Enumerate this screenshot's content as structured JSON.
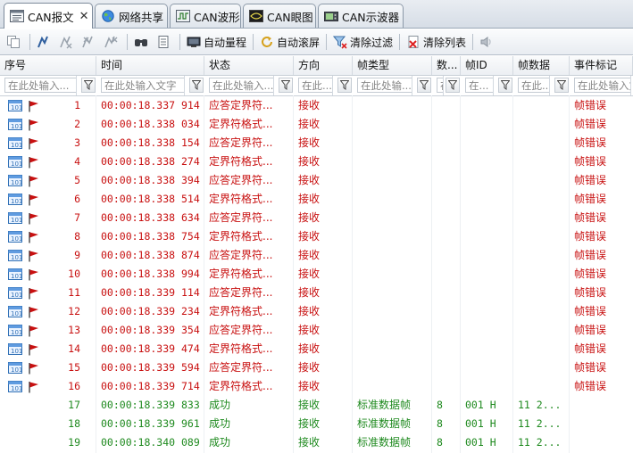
{
  "colors": {
    "error_text": "#c81010",
    "success_text": "#1f8a1f"
  },
  "tabs": [
    {
      "label": "CAN报文",
      "icon": "message-list-icon",
      "active": true,
      "close": "✕"
    },
    {
      "label": "网络共享",
      "icon": "globe-icon",
      "active": false
    },
    {
      "label": "CAN波形",
      "icon": "waveform-icon",
      "active": false
    },
    {
      "label": "CAN眼图",
      "icon": "eye-diagram-icon",
      "active": false
    },
    {
      "label": "CAN示波器",
      "icon": "oscilloscope-icon",
      "active": false
    }
  ],
  "toolbar": {
    "auto_scale_label": "自动量程",
    "auto_scroll_label": "自动滚屏",
    "clear_filter_label": "清除过滤",
    "clear_list_label": "清除列表"
  },
  "columns": [
    {
      "label": "序号",
      "filter": "在此处输入..."
    },
    {
      "label": "时间",
      "filter": "在此处输入文字"
    },
    {
      "label": "状态",
      "filter": "在此处输入..."
    },
    {
      "label": "方向",
      "filter": "在此..."
    },
    {
      "label": "帧类型",
      "filter": "在此处输..."
    },
    {
      "label": "数...",
      "filter": "在"
    },
    {
      "label": "帧ID",
      "filter": "在..."
    },
    {
      "label": "帧数据",
      "filter": "在此..."
    },
    {
      "label": "事件标记",
      "filter": "在此处输入文"
    }
  ],
  "rows": [
    {
      "no": "1",
      "time": "00:00:18.337 914",
      "status": "应答定界符...",
      "dir": "接收",
      "frame_type": "",
      "len": "",
      "id": "",
      "data": "",
      "event": "帧错误",
      "kind": "error"
    },
    {
      "no": "2",
      "time": "00:00:18.338 034",
      "status": "定界符格式...",
      "dir": "接收",
      "frame_type": "",
      "len": "",
      "id": "",
      "data": "",
      "event": "帧错误",
      "kind": "error"
    },
    {
      "no": "3",
      "time": "00:00:18.338 154",
      "status": "应答定界符...",
      "dir": "接收",
      "frame_type": "",
      "len": "",
      "id": "",
      "data": "",
      "event": "帧错误",
      "kind": "error"
    },
    {
      "no": "4",
      "time": "00:00:18.338 274",
      "status": "定界符格式...",
      "dir": "接收",
      "frame_type": "",
      "len": "",
      "id": "",
      "data": "",
      "event": "帧错误",
      "kind": "error"
    },
    {
      "no": "5",
      "time": "00:00:18.338 394",
      "status": "应答定界符...",
      "dir": "接收",
      "frame_type": "",
      "len": "",
      "id": "",
      "data": "",
      "event": "帧错误",
      "kind": "error"
    },
    {
      "no": "6",
      "time": "00:00:18.338 514",
      "status": "定界符格式...",
      "dir": "接收",
      "frame_type": "",
      "len": "",
      "id": "",
      "data": "",
      "event": "帧错误",
      "kind": "error"
    },
    {
      "no": "7",
      "time": "00:00:18.338 634",
      "status": "应答定界符...",
      "dir": "接收",
      "frame_type": "",
      "len": "",
      "id": "",
      "data": "",
      "event": "帧错误",
      "kind": "error"
    },
    {
      "no": "8",
      "time": "00:00:18.338 754",
      "status": "定界符格式...",
      "dir": "接收",
      "frame_type": "",
      "len": "",
      "id": "",
      "data": "",
      "event": "帧错误",
      "kind": "error"
    },
    {
      "no": "9",
      "time": "00:00:18.338 874",
      "status": "应答定界符...",
      "dir": "接收",
      "frame_type": "",
      "len": "",
      "id": "",
      "data": "",
      "event": "帧错误",
      "kind": "error"
    },
    {
      "no": "10",
      "time": "00:00:18.338 994",
      "status": "定界符格式...",
      "dir": "接收",
      "frame_type": "",
      "len": "",
      "id": "",
      "data": "",
      "event": "帧错误",
      "kind": "error"
    },
    {
      "no": "11",
      "time": "00:00:18.339 114",
      "status": "应答定界符...",
      "dir": "接收",
      "frame_type": "",
      "len": "",
      "id": "",
      "data": "",
      "event": "帧错误",
      "kind": "error"
    },
    {
      "no": "12",
      "time": "00:00:18.339 234",
      "status": "定界符格式...",
      "dir": "接收",
      "frame_type": "",
      "len": "",
      "id": "",
      "data": "",
      "event": "帧错误",
      "kind": "error"
    },
    {
      "no": "13",
      "time": "00:00:18.339 354",
      "status": "应答定界符...",
      "dir": "接收",
      "frame_type": "",
      "len": "",
      "id": "",
      "data": "",
      "event": "帧错误",
      "kind": "error"
    },
    {
      "no": "14",
      "time": "00:00:18.339 474",
      "status": "定界符格式...",
      "dir": "接收",
      "frame_type": "",
      "len": "",
      "id": "",
      "data": "",
      "event": "帧错误",
      "kind": "error"
    },
    {
      "no": "15",
      "time": "00:00:18.339 594",
      "status": "应答定界符...",
      "dir": "接收",
      "frame_type": "",
      "len": "",
      "id": "",
      "data": "",
      "event": "帧错误",
      "kind": "error"
    },
    {
      "no": "16",
      "time": "00:00:18.339 714",
      "status": "定界符格式...",
      "dir": "接收",
      "frame_type": "",
      "len": "",
      "id": "",
      "data": "",
      "event": "帧错误",
      "kind": "error"
    },
    {
      "no": "17",
      "time": "00:00:18.339 833",
      "status": "成功",
      "dir": "接收",
      "frame_type": "标准数据帧",
      "len": "8",
      "id": "001 H",
      "data": "11 2...",
      "event": "",
      "kind": "ok"
    },
    {
      "no": "18",
      "time": "00:00:18.339 961",
      "status": "成功",
      "dir": "接收",
      "frame_type": "标准数据帧",
      "len": "8",
      "id": "001 H",
      "data": "11 2...",
      "event": "",
      "kind": "ok"
    },
    {
      "no": "19",
      "time": "00:00:18.340 089",
      "status": "成功",
      "dir": "接收",
      "frame_type": "标准数据帧",
      "len": "8",
      "id": "001 H",
      "data": "11 2...",
      "event": "",
      "kind": "ok"
    }
  ]
}
